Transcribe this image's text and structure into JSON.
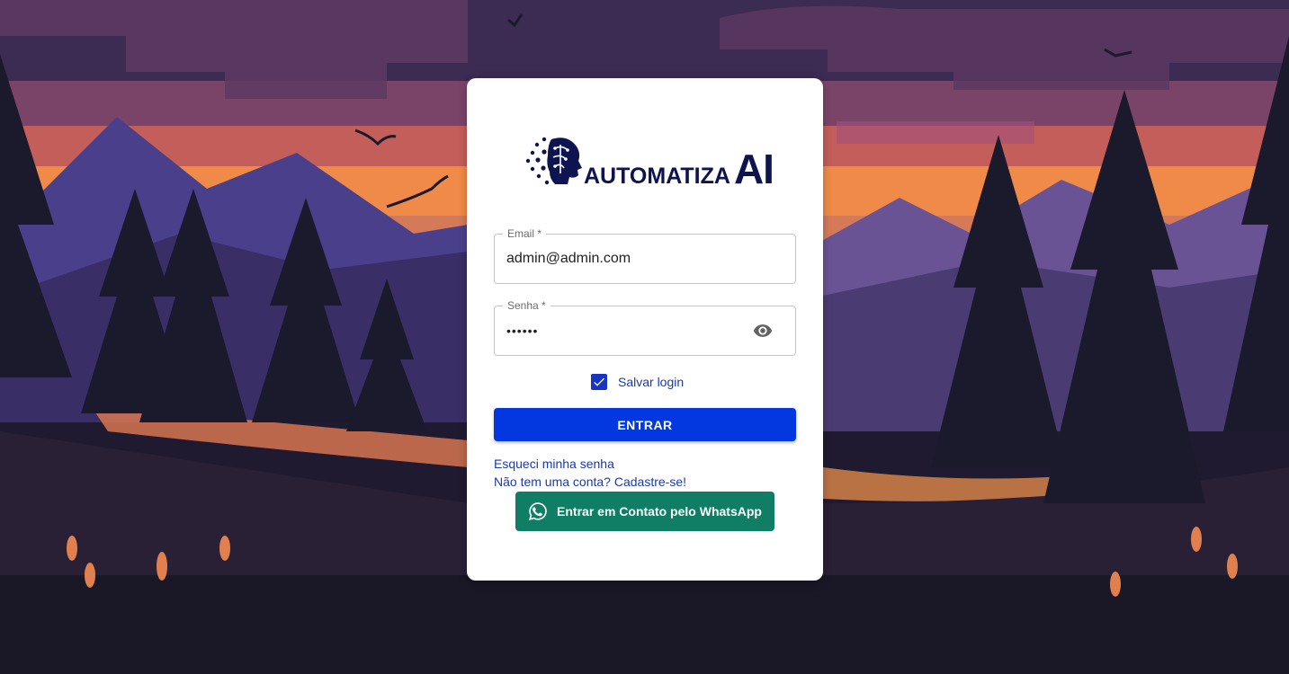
{
  "logo": {
    "word": "AUTOMATIZA",
    "ai": "AI",
    "color": "#0e1450"
  },
  "form": {
    "email": {
      "label": "Email *",
      "value": "admin@admin.com"
    },
    "password": {
      "label": "Senha *",
      "value": "••••••",
      "toggle_icon": "eye-icon"
    },
    "remember": {
      "label": "Salvar login",
      "checked": true
    },
    "submit_label": "ENTRAR",
    "forgot_link": "Esqueci minha senha",
    "signup_link": "Não tem uma conta? Cadastre-se!",
    "whatsapp_label": "Entrar em Contato pelo WhatsApp",
    "whatsapp_icon": "whatsapp-icon"
  },
  "colors": {
    "primary": "#0338e0",
    "link": "#1a3aa8",
    "whatsapp": "#0f7e64"
  }
}
